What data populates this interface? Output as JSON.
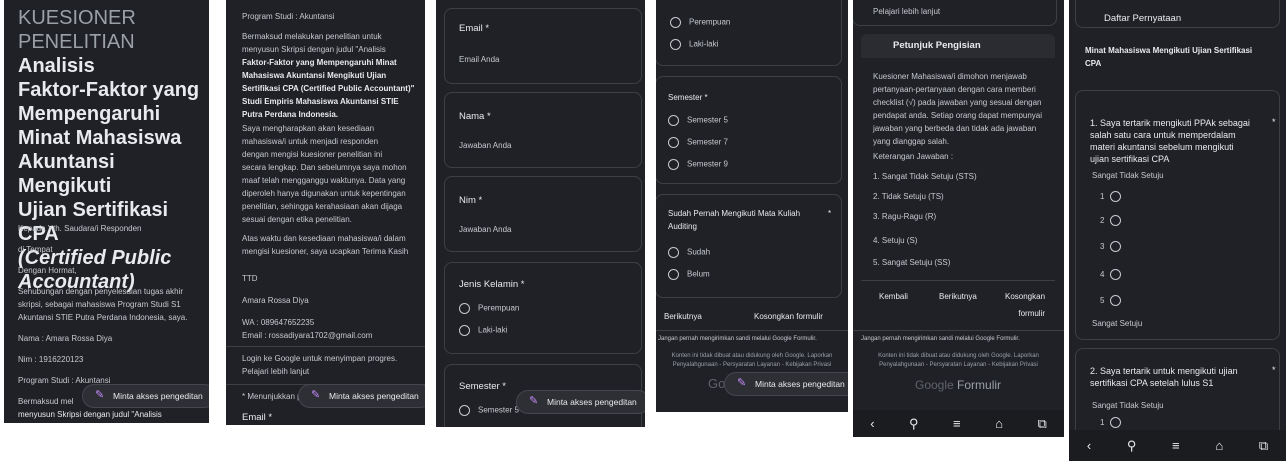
{
  "fab_label": "Minta akses pengeditan",
  "p1": {
    "title_lines": [
      "KUESIONER",
      "PENELITIAN",
      "Analisis",
      "Faktor-Faktor yang",
      "Mempengaruhi",
      "Minat Mahasiswa",
      "Akuntansi Mengikuti",
      "Ujian Sertifikasi CPA",
      "(Certified Public",
      "Accountant)"
    ],
    "greet": "Kepada Yth. Saudara/i Responden",
    "place": "di Tempat",
    "hormat": "Dengan Hormat,",
    "intro_lines": [
      "Sehubungan dengan penyelesaian tugas akhir",
      "skripsi, sebagai mahasiswa Program Studi S1",
      "Akuntansi STIE Putra Perdana Indonesia, saya."
    ],
    "nama": "Nama : Amara Rossa Diya",
    "nim": "Nim : 1916220123",
    "prodi": "Program Studi : Akuntansi",
    "bottom": [
      "Bermaksud mel",
      "menyusun Skripsi dengan judul \"Analisis"
    ]
  },
  "p2": {
    "prodi": "Program Studi : Akuntansi",
    "para1": [
      "Bermaksud melakukan penelitian untuk",
      "menyusun Skripsi dengan judul \"Analisis",
      "Faktor-Faktor yang Mempengaruhi Minat",
      "Mahasiswa Akuntansi Mengikuti Ujian",
      "Sertifikasi CPA (Certified Public Accountant)\"",
      "Studi Empiris Mahasiswa Akuntansi STIE",
      "Putra Perdana Indonesia."
    ],
    "para2": [
      "Saya mengharapkan akan kesediaan",
      "mahasiswa/i untuk menjadi responden",
      "dengan mengisi kuesioner penelitian ini",
      "secara lengkap. Dan sebelumnya saya mohon",
      "maaf telah mengganggu waktunya. Data yang",
      "diperoleh hanya digunakan untuk kepentingan",
      "penelitian, sehingga kerahasiaan akan dijaga",
      "sesuai dengan etika penelitian."
    ],
    "para3": [
      "Atas waktu dan kesediaan mahasiswa/i dalam",
      "mengisi kuesioner, saya ucapkan Terima Kasih"
    ],
    "ttd": "TTD",
    "name": "Amara Rossa Diya",
    "wa": "WA : 089647652235",
    "email": "Email : rossadiyara1702@gmail.com",
    "login": [
      "Login ke Google untuk menyimpan progres.",
      "Pelajari lebih lanjut"
    ],
    "required": "* Menunjukkan pertanyaan yang wajib diisi",
    "email_label": "Email *"
  },
  "p3": {
    "email_label": "Email *",
    "email_ph": "Email Anda",
    "nama_label": "Nama *",
    "nama_ph": "Jawaban Anda",
    "nim_label": "Nim *",
    "nim_ph": "Jawaban Anda",
    "jk_label": "Jenis Kelamin *",
    "jk_opts": [
      "Perempuan",
      "Laki-laki"
    ],
    "sem_label": "Semester *",
    "sem_opt": "Semester 5"
  },
  "p4": {
    "jk_opts": [
      "Perempuan",
      "Laki-laki"
    ],
    "sem_label": "Semester *",
    "sem_opts": [
      "Semester 5",
      "Semester 7",
      "Semester 9"
    ],
    "aud_label": [
      "Sudah Pernah Mengikuti Mata Kuliah",
      "Auditing"
    ],
    "aud_star": "*",
    "aud_opts": [
      "Sudah",
      "Belum"
    ],
    "next": "Berikutnya",
    "clear": "Kosongkan formulir",
    "pw": "Jangan pernah mengirimkan sandi melalui Google Formulir.",
    "foot": [
      "Konten ini tidak dibuat atau didukung oleh Google. Laporkan",
      "Penyalahgunaan - Persyaratan Layanan - Kebijakan Privasi"
    ],
    "logo": "Go"
  },
  "p5": {
    "top": "Pelajari lebih lanjut",
    "header": "Petunjuk Pengisian",
    "para": [
      "Kuesioner Mahasiswa/i dimohon menjawab",
      "pertanyaan-pertanyaan dengan cara memberi",
      "checklist (√) pada jawaban yang sesuai dengan",
      "pendapat anda. Setiap orang dapat mempunyai",
      "jawaban yang berbeda dan tidak ada jawaban",
      "yang dianggap salah."
    ],
    "ket": "Keterangan Jawaban :",
    "scale": [
      "1. Sangat Tidak Setuju (STS)",
      "2. Tidak Setuju (TS)",
      "3. Ragu-Ragu (R)",
      "4. Setuju (S)",
      "5. Sangat Setuju (SS)"
    ],
    "back": "Kembali",
    "next": "Berikutnya",
    "clear1": "Kosongkan",
    "clear2": "formulir",
    "pw": "Jangan pernah mengirimkan sandi melalui Google Formulir.",
    "foot": [
      "Konten ini tidak dibuat atau didukung oleh Google. Laporkan",
      "Penyalahgunaan - Persyaratan Layanan - Kebijakan Privasi"
    ],
    "logo_g": "Google",
    "logo_f": "Formulir"
  },
  "p6": {
    "header": "Daftar Pernyataan",
    "section": [
      "Minat Mahasiswa Mengikuti Ujian Sertifikasi",
      "CPA"
    ],
    "q1": [
      "1. Saya tertarik mengikuti PPAk sebagai",
      "salah satu cara untuk memperdalam",
      "materi akuntansi sebelum mengikuti",
      "ujian sertifikasi CPA"
    ],
    "q1_star": "*",
    "low": "Sangat Tidak Setuju",
    "high": "Sangat Setuju",
    "nums": [
      "1",
      "2",
      "3",
      "4",
      "5"
    ],
    "q2": [
      "2. Saya tertarik untuk mengikuti ujian",
      "sertifikasi CPA setelah lulus S1"
    ],
    "q2_star": "*",
    "low2": "Sangat Tidak Setuju",
    "q2_num": "1"
  },
  "nav": {
    "back": "‹",
    "search": "⚲",
    "menu": "≡",
    "home": "⌂",
    "tabs": "⧉"
  },
  "colors": {
    "background": "#1f2127",
    "card_border": "#3c4043",
    "accent": "#c58af9",
    "nav_bg": "#1b1c20"
  }
}
